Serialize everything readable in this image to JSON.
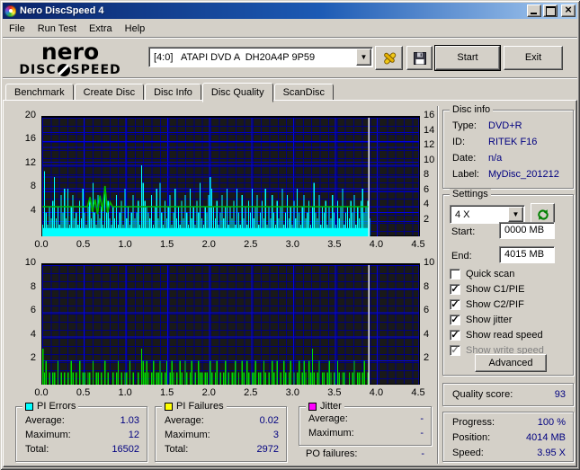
{
  "window": {
    "title": "Nero DiscSpeed 4"
  },
  "menu": {
    "items": [
      {
        "label": "File"
      },
      {
        "label": "Run Test"
      },
      {
        "label": "Extra"
      },
      {
        "label": "Help"
      }
    ]
  },
  "logo": {
    "nero": "nero",
    "disc": "DISC",
    "speed": "SPEED"
  },
  "toolbar": {
    "drive": "[4:0]   ATAPI DVD A  DH20A4P 9P59",
    "start_label": "Start",
    "exit_label": "Exit"
  },
  "tabs": [
    {
      "label": "Benchmark"
    },
    {
      "label": "Create Disc"
    },
    {
      "label": "Disc Info"
    },
    {
      "label": "Disc Quality"
    },
    {
      "label": "ScanDisc"
    }
  ],
  "disc_info": {
    "title": "Disc info",
    "rows": [
      {
        "label": "Type:",
        "value": "DVD+R"
      },
      {
        "label": "ID:",
        "value": "RITEK F16"
      },
      {
        "label": "Date:",
        "value": "n/a"
      },
      {
        "label": "Label:",
        "value": "MyDisc_201212"
      }
    ]
  },
  "settings": {
    "title": "Settings",
    "speed": "4 X",
    "start_label": "Start:",
    "start_value": "0000 MB",
    "end_label": "End:",
    "end_value": "4015 MB",
    "checkboxes": [
      {
        "label": "Quick scan",
        "checked": false,
        "enabled": true
      },
      {
        "label": "Show C1/PIE",
        "checked": true,
        "enabled": true
      },
      {
        "label": "Show C2/PIF",
        "checked": true,
        "enabled": true
      },
      {
        "label": "Show jitter",
        "checked": true,
        "enabled": true
      },
      {
        "label": "Show read speed",
        "checked": true,
        "enabled": true
      },
      {
        "label": "Show write speed",
        "checked": true,
        "enabled": false
      }
    ],
    "advanced_label": "Advanced"
  },
  "quality": {
    "label": "Quality score:",
    "value": "93"
  },
  "status": {
    "rows": [
      {
        "label": "Progress:",
        "value": "100 %"
      },
      {
        "label": "Position:",
        "value": "4014 MB"
      },
      {
        "label": "Speed:",
        "value": "3.95 X"
      }
    ]
  },
  "legends": [
    {
      "title": "PI Errors",
      "color": "#00FFFF",
      "rows": [
        {
          "label": "Average:",
          "value": "1.03"
        },
        {
          "label": "Maximum:",
          "value": "12"
        },
        {
          "label": "Total:",
          "value": "16502"
        }
      ]
    },
    {
      "title": "PI Failures",
      "color": "#FFFF00",
      "rows": [
        {
          "label": "Average:",
          "value": "0.02"
        },
        {
          "label": "Maximum:",
          "value": "3"
        },
        {
          "label": "Total:",
          "value": "2972"
        }
      ]
    },
    {
      "title": "Jitter",
      "color": "#FF00FF",
      "rows": [
        {
          "label": "Average:",
          "value": "-"
        },
        {
          "label": "Maximum:",
          "value": "-"
        }
      ]
    }
  ],
  "po_failures": {
    "label": "PO failures:",
    "value": "-"
  },
  "chart_data": [
    {
      "type": "area",
      "name": "PI Errors / Read speed",
      "x_axis": {
        "min": 0,
        "max": 4.5,
        "ticks": [
          "0.0",
          "0.5",
          "1.0",
          "1.5",
          "2.0",
          "2.5",
          "3.0",
          "3.5",
          "4.0",
          "4.5"
        ]
      },
      "left_axis": {
        "min": 0,
        "max": 20,
        "ticks": [
          4,
          8,
          12,
          16,
          20
        ]
      },
      "right_axis": {
        "min": 0,
        "max": 16,
        "ticks": [
          2,
          4,
          6,
          8,
          10,
          12,
          14,
          16
        ]
      },
      "x_start": 0,
      "x_step": 0.02,
      "data_end": 3.9,
      "marker_x": 3.9,
      "bg": "#191919",
      "grid_minor": "#000080",
      "grid_major": "#0000E6",
      "grid_major2": "#0000C0",
      "marker_color": "#EDEDED",
      "series": [
        {
          "name": "PI Errors",
          "color": "#00FFFF",
          "axis": "left",
          "draw": "spikes",
          "baseline": 1.4,
          "values": [
            2,
            11,
            4,
            2,
            5,
            3,
            6,
            10,
            3,
            5,
            2,
            7,
            4,
            8,
            3,
            8,
            2,
            5,
            7,
            3,
            4,
            2,
            6,
            3,
            8,
            4,
            2,
            5,
            6,
            3,
            9,
            4,
            2,
            7,
            3,
            5,
            2,
            8,
            4,
            6,
            3,
            2,
            5,
            3,
            7,
            2,
            4,
            6,
            2,
            8,
            3,
            5,
            2,
            4,
            7,
            3,
            4,
            6,
            2,
            12,
            9,
            6,
            5,
            4,
            3,
            7,
            2,
            5,
            8,
            3,
            9,
            4,
            2,
            6,
            3,
            5,
            7,
            2,
            4,
            8,
            3,
            5,
            2,
            6,
            3,
            7,
            4,
            2,
            8,
            3,
            5,
            2,
            6,
            4,
            9,
            3,
            2,
            5,
            4,
            7,
            10,
            8,
            5,
            3,
            6,
            2,
            4,
            7,
            3,
            5,
            8,
            2,
            5,
            3,
            6,
            2,
            8,
            4,
            2,
            7,
            3,
            5,
            2,
            6,
            4,
            8,
            3,
            5,
            7,
            2,
            4,
            6,
            3,
            8,
            2,
            5,
            3,
            7,
            4,
            2,
            6,
            3,
            5,
            8,
            2,
            4,
            7,
            3,
            5,
            2,
            6,
            3,
            8,
            4,
            2,
            5,
            7,
            3,
            4,
            6,
            2,
            5,
            9,
            4,
            3,
            7,
            2,
            5,
            4,
            6,
            2,
            5,
            3,
            7,
            4,
            2,
            6,
            3,
            5,
            8,
            2,
            4,
            5,
            3,
            6,
            4,
            7,
            2,
            5,
            3,
            6,
            8,
            4,
            5,
            6,
            3
          ]
        },
        {
          "name": "Read speed",
          "color": "#00BE00",
          "axis": "right",
          "draw": "line",
          "points": [
            [
              0,
              4
            ],
            [
              0.54,
              4
            ],
            [
              0.57,
              5.3
            ],
            [
              0.6,
              3.3
            ],
            [
              0.63,
              5.0
            ],
            [
              0.66,
              3.0
            ],
            [
              0.69,
              5.5
            ],
            [
              0.72,
              3.4
            ],
            [
              0.75,
              6.8
            ],
            [
              0.78,
              3.2
            ],
            [
              0.81,
              4.6
            ],
            [
              0.84,
              4
            ],
            [
              3.9,
              4
            ]
          ]
        }
      ]
    },
    {
      "type": "bar",
      "name": "PI Failures",
      "x_axis": {
        "min": 0,
        "max": 4.5,
        "ticks": [
          "0.0",
          "0.5",
          "1.0",
          "1.5",
          "2.0",
          "2.5",
          "3.0",
          "3.5",
          "4.0",
          "4.5"
        ]
      },
      "left_axis": {
        "min": 0,
        "max": 10,
        "ticks": [
          2,
          4,
          6,
          8,
          10
        ]
      },
      "right_axis": {
        "min": 0,
        "max": 10,
        "ticks": [
          2,
          4,
          6,
          8,
          10
        ]
      },
      "x_start": 0,
      "x_step": 0.02,
      "data_end": 3.9,
      "marker_x": 3.9,
      "bg": "#191919",
      "grid_minor": "#000080",
      "grid_major": "#0000E6",
      "marker_color": "#EDEDED",
      "series": [
        {
          "name": "PI Failures",
          "color": "#00DC00",
          "axis": "left",
          "draw": "bars",
          "values": [
            3,
            1,
            2,
            0,
            1,
            0,
            1,
            1,
            0,
            2,
            0,
            1,
            0,
            1,
            0,
            1,
            0,
            2,
            1,
            0,
            1,
            0,
            2,
            0,
            1,
            1,
            0,
            1,
            1,
            0,
            2,
            0,
            1,
            1,
            0,
            1,
            0,
            2,
            0,
            1,
            0,
            0,
            1,
            0,
            1,
            2,
            0,
            1,
            0,
            1,
            1,
            0,
            2,
            0,
            1,
            0,
            0,
            1,
            0,
            3,
            2,
            1,
            2,
            1,
            0,
            1,
            2,
            0,
            1,
            1,
            2,
            1,
            0,
            1,
            2,
            0,
            1,
            2,
            1,
            0,
            1,
            0,
            2,
            1,
            0,
            2,
            1,
            0,
            1,
            2,
            0,
            1,
            0,
            2,
            1,
            1,
            0,
            1,
            1,
            0,
            2,
            1,
            0,
            1,
            2,
            0,
            1,
            0,
            1,
            2,
            0,
            1,
            0,
            1,
            1,
            2,
            0,
            1,
            0,
            2,
            1,
            0,
            2,
            1,
            0,
            1,
            1,
            2,
            0,
            1,
            1,
            0,
            2,
            1,
            0,
            1,
            0,
            2,
            1,
            0,
            2,
            0,
            1,
            0,
            2,
            1,
            0,
            1,
            2,
            0,
            1,
            0,
            1,
            2,
            0,
            1,
            2,
            1,
            0,
            2,
            1,
            3,
            1,
            0,
            1,
            2,
            0,
            1,
            1,
            0,
            1,
            2,
            1,
            0,
            1,
            0,
            2,
            1,
            0,
            1,
            1,
            0,
            0,
            1,
            0,
            1,
            2,
            0,
            1,
            1,
            0,
            1,
            2,
            0,
            1,
            0
          ]
        }
      ]
    }
  ]
}
